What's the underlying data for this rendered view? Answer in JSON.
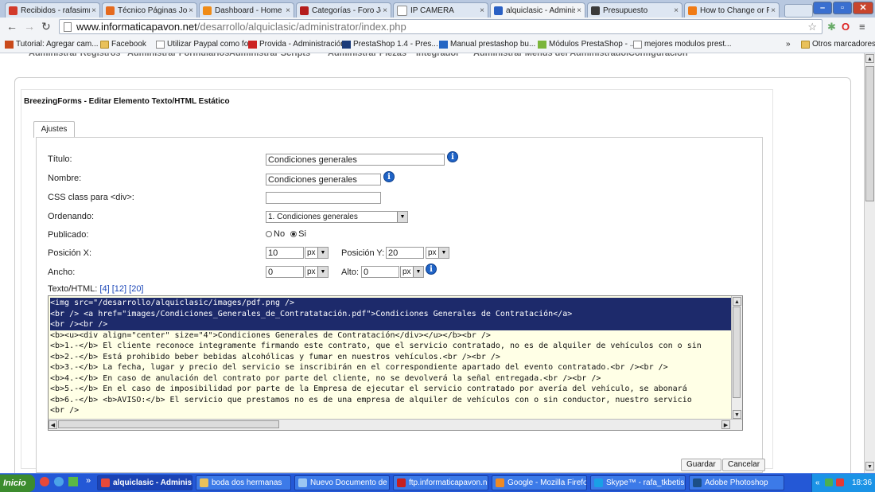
{
  "browser": {
    "tabs": [
      {
        "label": "Recibidos - rafasimm",
        "favicon": "gmail-icon",
        "color": "#d23a2b",
        "active": false
      },
      {
        "label": "Técnico Páginas Joo",
        "favicon": "joomla-icon",
        "color": "#e56a1f",
        "active": false
      },
      {
        "label": "Dashboard - Home",
        "favicon": "orange-square-icon",
        "color": "#f08b16",
        "active": false
      },
      {
        "label": "Categorías - Foro Jo",
        "favicon": "w-icon",
        "color": "#b51d1d",
        "active": false
      },
      {
        "label": "IP CAMERA",
        "favicon": "page-icon",
        "color": "#ffffff",
        "active": false
      },
      {
        "label": "alquiclasic - Administ",
        "favicon": "joomla-icon",
        "color": "#2a60c4",
        "active": true
      },
      {
        "label": "Presupuesto",
        "favicon": "dark-icon",
        "color": "#3a3a3a",
        "active": false
      },
      {
        "label": "How to Change or R",
        "favicon": "blogger-icon",
        "color": "#f07b16",
        "active": false
      }
    ],
    "address": {
      "host": "www.informaticapavon.net",
      "path": "/desarrollo/alquiclasic/administrator/index.php"
    },
    "bookmarks": [
      {
        "label": "Tutorial: Agregar cam...",
        "icon": "app-icon"
      },
      {
        "label": "Facebook",
        "icon": "folder-icon"
      },
      {
        "label": "Utilizar Paypal como fo...",
        "icon": "page-icon"
      },
      {
        "label": "Provida - Administración",
        "icon": "red-icon"
      },
      {
        "label": "PrestaShop 1.4 - Pres...",
        "icon": "prestashop-icon"
      },
      {
        "label": "Manual prestashop bu...",
        "icon": "globe-icon"
      },
      {
        "label": "Módulos PrestaShop - ...",
        "icon": "green-icon"
      },
      {
        "label": "mejores modulos prest...",
        "icon": "page-icon"
      }
    ],
    "bookmarks_more": "»",
    "other_bookmarks": "Otros marcadores"
  },
  "topnav": [
    "Administrar Registros",
    "Administrar Formularios",
    "Administrar Scripts",
    "Administrar Piezas",
    "Integrador",
    "Administrar Menús del Administrador",
    "Configuración"
  ],
  "form": {
    "title": "BreezingForms - Editar Elemento Texto/HTML Estático",
    "tab_label": "Ajustes",
    "fields": {
      "titulo_label": "Título:",
      "titulo_value": "Condiciones generales",
      "nombre_label": "Nombre:",
      "nombre_value": "Condiciones generales",
      "css_label": "CSS class para <div>:",
      "css_value": "",
      "ordenando_label": "Ordenando:",
      "ordenando_value": "1. Condiciones generales",
      "publicado_label": "Publicado:",
      "publicado_no": "No",
      "publicado_si": "Si",
      "publicado_selected": "Si",
      "posx_label": "Posición X:",
      "posx_value": "10",
      "posx_unit": "px",
      "posy_label": "Posición Y:",
      "posy_value": "20",
      "posy_unit": "px",
      "ancho_label": "Ancho:",
      "ancho_value": "0",
      "ancho_unit": "px",
      "alto_label": "Alto:",
      "alto_value": "0",
      "alto_unit": "px"
    },
    "texthtml_label": "Texto/HTML:",
    "texthtml_links": [
      "[4]",
      "[12]",
      "[20]"
    ],
    "code_lines": [
      "<img src=\"/desarrollo/alquiclasic/images/pdf.png />",
      "<br /> <a href=\"images/Condiciones_Generales_de_Contratatación.pdf\">Condiciones Generales de Contratación</a>",
      "<br /><br />",
      "<b><u><div align=\"center\" size=\"4\">Condiciones Generales de Contratación</div></u></b><br />",
      "<b>1.-</b> El cliente reconoce integramente firmando este contrato, que el servicio contratado, no es de alquiler de vehículos con o sin",
      "<b>2.-</b> Está prohibido beber bebidas alcohólicas y fumar en nuestros vehículos.<br /><br />",
      "<b>3.-</b> La fecha, lugar y precio del servicio se inscribirán en el correspondiente apartado del evento contratado.<br /><br />",
      "<b>4.-</b> En caso de anulación del contrato por parte del cliente, no se devolverá la señal entregada.<br /><br />",
      "<b>5.-</b> En el caso de imposibilidad por parte de la Empresa de ejecutar el servicio contratado por avería del vehículo, se abonará",
      "<b>6.-</b> <b>AVISO:</b> El servicio que prestamos no es de una empresa de alquiler de vehículos con o sin conductor, nuestro servicio",
      "<br />"
    ],
    "selected_lines": 3,
    "buttons": {
      "save": "Guardar",
      "cancel": "Cancelar"
    }
  },
  "taskbar": {
    "start": "Inicio",
    "tasks": [
      {
        "label": "alquiclasic - Adminis...",
        "active": true,
        "icon": "chrome-icon"
      },
      {
        "label": "boda dos hermanas",
        "active": false,
        "icon": "folder-icon"
      },
      {
        "label": "Nuevo Documento de ...",
        "active": false,
        "icon": "notepad-icon"
      },
      {
        "label": "ftp.informaticapavon.n...",
        "active": false,
        "icon": "filezilla-icon"
      },
      {
        "label": "Google - Mozilla Firefox",
        "active": false,
        "icon": "firefox-icon"
      },
      {
        "label": "Skype™ - rafa_tkbetis...",
        "active": false,
        "icon": "skype-icon"
      },
      {
        "label": "Adobe Photoshop",
        "active": false,
        "icon": "photoshop-icon"
      }
    ],
    "clock": "18:36"
  }
}
